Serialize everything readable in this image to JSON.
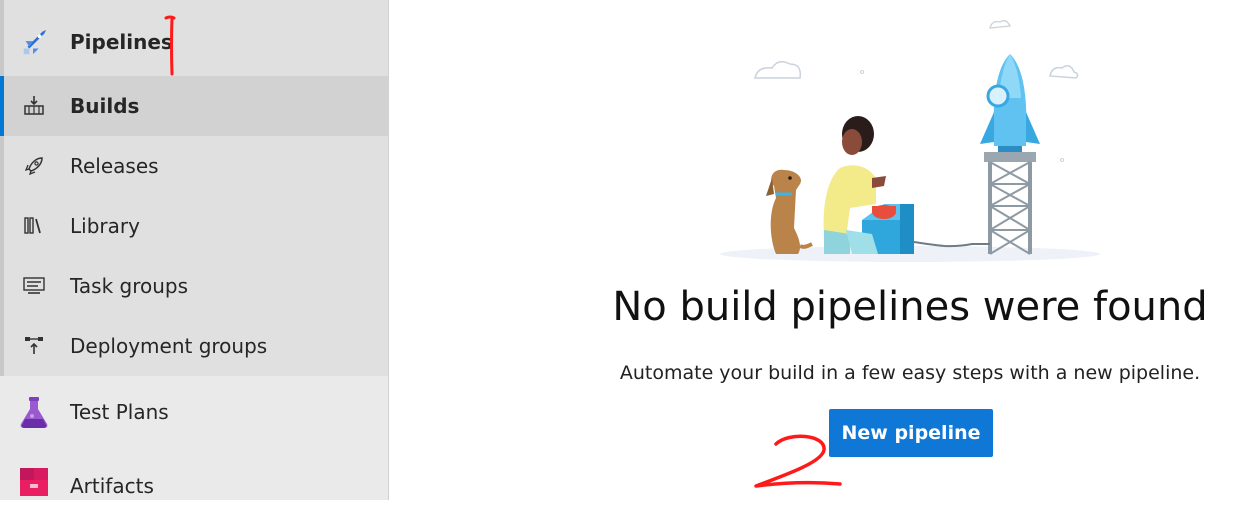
{
  "sidebar": {
    "header": {
      "label": "Pipelines",
      "icon": "pipelines-icon"
    },
    "items": [
      {
        "label": "Builds",
        "icon": "builds-icon",
        "selected": true
      },
      {
        "label": "Releases",
        "icon": "rocket-icon"
      },
      {
        "label": "Library",
        "icon": "library-icon"
      },
      {
        "label": "Task groups",
        "icon": "task-groups-icon"
      },
      {
        "label": "Deployment groups",
        "icon": "deployment-groups-icon"
      }
    ],
    "other": [
      {
        "label": "Test Plans",
        "icon": "flask-icon"
      },
      {
        "label": "Artifacts",
        "icon": "package-icon"
      }
    ]
  },
  "main": {
    "title": "No build pipelines were found",
    "subtitle": "Automate your build in a few easy steps with a new pipeline.",
    "button_label": "New pipeline"
  },
  "colors": {
    "accent": "#0078d4",
    "button": "#0f78d7",
    "annotation": "#ff1a1a"
  }
}
